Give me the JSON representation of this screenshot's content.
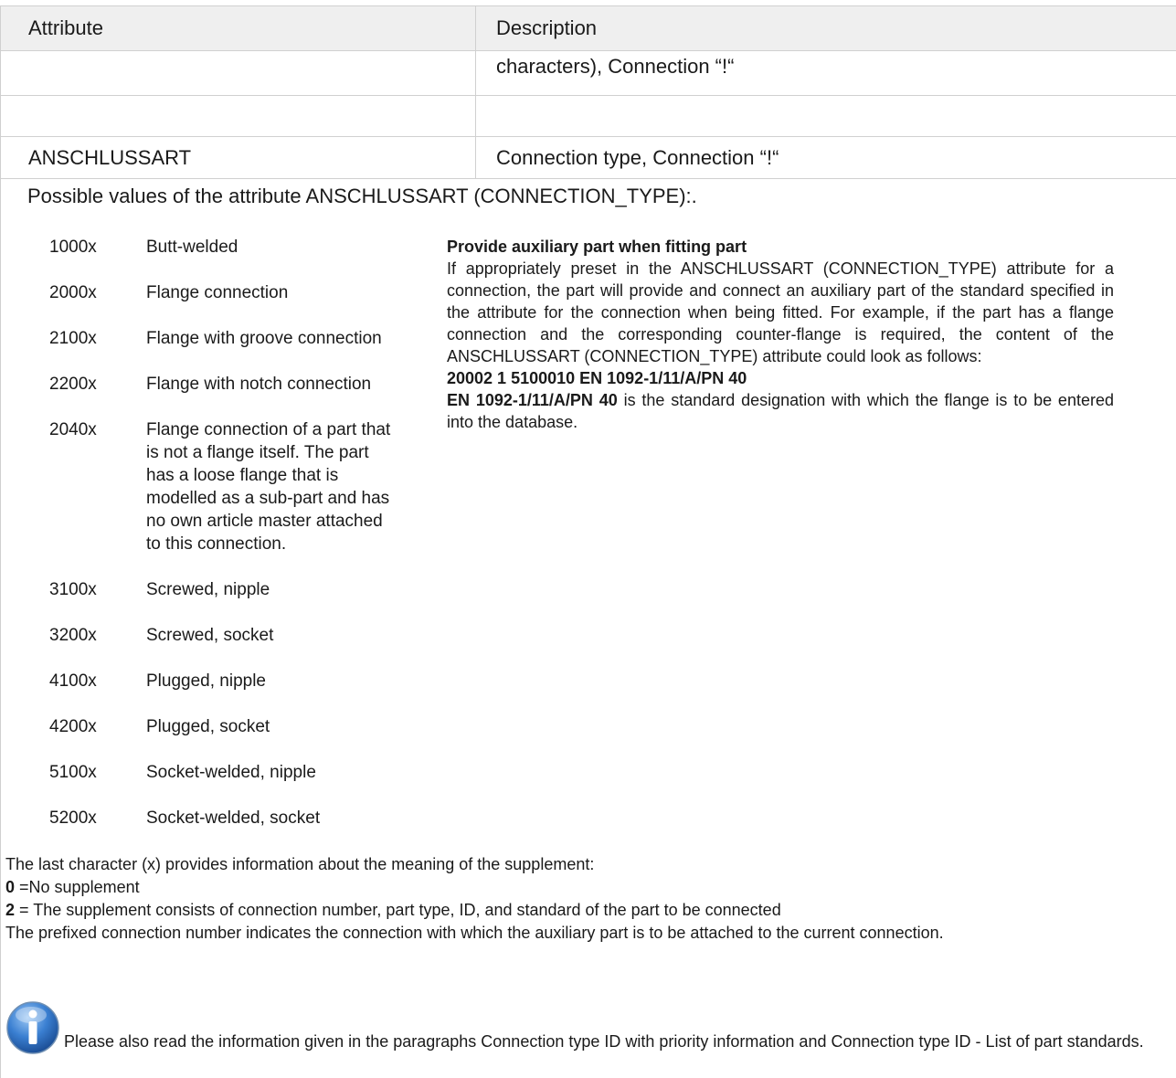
{
  "table": {
    "headers": [
      "Attribute",
      "Description"
    ],
    "rows": [
      {
        "attribute": "",
        "description": "characters), Connection “!“"
      },
      {
        "attribute": "",
        "description": ""
      },
      {
        "attribute": "ANSCHLUSSART",
        "description": "Connection type, Connection “!“"
      }
    ]
  },
  "intro": "Possible values of the attribute ANSCHLUSSART (CONNECTION_TYPE):.",
  "codes": [
    {
      "code": "1000x",
      "desc": "Butt-welded"
    },
    {
      "code": "2000x",
      "desc": "Flange connection"
    },
    {
      "code": "2100x",
      "desc": "Flange with groove connection"
    },
    {
      "code": "2200x",
      "desc": "Flange with notch connection"
    },
    {
      "code": "2040x",
      "desc": "Flange connection of a part that is not a flange itself. The part has a loose flange that is modelled as a sub-part and has no own article master attached to this connection."
    },
    {
      "code": "3100x",
      "desc": "Screwed, nipple"
    },
    {
      "code": "3200x",
      "desc": "Screwed, socket"
    },
    {
      "code": "4100x",
      "desc": "Plugged, nipple"
    },
    {
      "code": "4200x",
      "desc": "Plugged, socket"
    },
    {
      "code": "5100x",
      "desc": "Socket-welded, nipple"
    },
    {
      "code": "5200x",
      "desc": "Socket-welded, socket"
    }
  ],
  "aux": {
    "title": "Provide auxiliary part when fitting part",
    "body": "If appropriately preset in the ANSCHLUSSART (CONNECTION_TYPE) attribute for a connection, the part will provide and connect an auxiliary part of the standard specified in the attribute for the connection when being fitted. For example, if the part has a flange connection and the corresponding counter-flange is required, the content of the ANSCHLUSSART (CONNECTION_TYPE) attribute could look as follows:",
    "example": "20002 1 5100010 EN 1092-1/11/A/PN 40",
    "std": "EN 1092-1/11/A/PN 40",
    "std_text": " is the standard designation with which the flange is to be entered into the database."
  },
  "footer": {
    "line1": "The last character (x) provides information about the meaning of the supplement:",
    "s0_key": "0",
    "s0_text": " =No supplement",
    "s2_key": "2",
    "s2_text": " = The supplement consists of connection number, part type, ID, and standard of the part to be connected",
    "line4": "The prefixed connection number indicates the connection with which the auxiliary part is to be attached to the current connection."
  },
  "note": {
    "icon": "info-icon",
    "text": "Please also read the information given in the paragraphs Connection type ID with priority information and Connection type ID - List of part standards."
  },
  "colors": {
    "header_bg": "#efefef",
    "border": "#d0d0d0",
    "icon_blue": "#2f6fbf"
  }
}
